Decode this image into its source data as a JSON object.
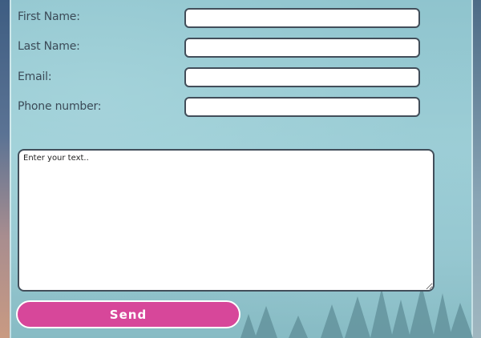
{
  "form": {
    "first_name_label": "First Name:",
    "last_name_label": "Last Name:",
    "email_label": "Email:",
    "phone_label": "Phone number:",
    "first_name_value": "",
    "last_name_value": "",
    "email_value": "",
    "phone_value": "",
    "message_placeholder": "Enter your text..",
    "send_label": "Send"
  },
  "colors": {
    "send_button": "#d7479a",
    "field_border": "#424e5a"
  }
}
